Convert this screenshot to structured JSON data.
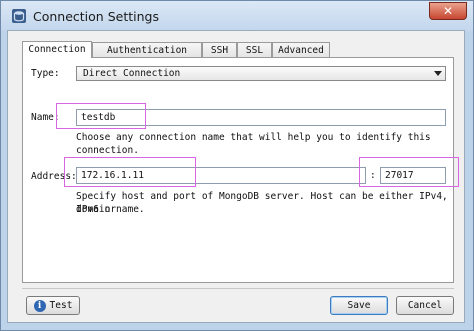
{
  "window": {
    "title": "Connection Settings",
    "close": "✕"
  },
  "tabs": [
    "Connection",
    "Authentication",
    "SSH",
    "SSL",
    "Advanced"
  ],
  "type": {
    "label": "Type:",
    "value": "Direct Connection"
  },
  "name": {
    "label": "Name:",
    "value": "testdb",
    "hint": "Choose any connection name that will help you to identify this connection."
  },
  "address": {
    "label": "Address:",
    "host": "172.16.1.11",
    "separator": ":",
    "port": "27017",
    "hint_line1": "Specify host and port of MongoDB server. Host can be either IPv4, IPv6 or",
    "hint_line2": "domain name."
  },
  "buttons": {
    "test": "Test",
    "save": "Save",
    "cancel": "Cancel"
  },
  "icons": {
    "title": "database-icon",
    "test": "info-icon"
  }
}
